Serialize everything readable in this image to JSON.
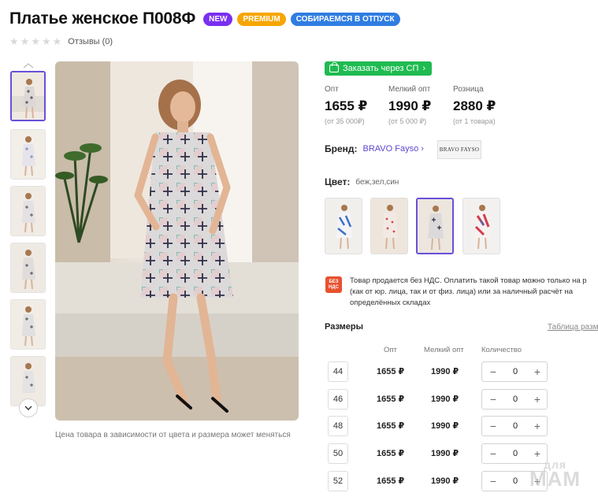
{
  "product": {
    "title": "Платье женское П008Ф",
    "badges": [
      "NEW",
      "PREMIUM",
      "СОБИРАЕМСЯ В ОТПУСК"
    ],
    "rating_stars": 5,
    "rating_value": 0,
    "reviews_label": "Отзывы (0)"
  },
  "gallery": {
    "up_arrow_icon": "chevron-up-icon",
    "down_arrow_icon": "chevron-down-icon",
    "thumbnails_count": 6,
    "active_thumbnail": 1,
    "caption": "Цена товара в зависимости от цвета и размера может меняться"
  },
  "order": {
    "button_label": "Заказать через СП",
    "button_icon": "cart-icon",
    "button_color": "#1fbb51"
  },
  "prices": [
    {
      "label": "Опт",
      "value": "1655 ₽",
      "note": "(от 35 000₽)"
    },
    {
      "label": "Мелкий опт",
      "value": "1990 ₽",
      "note": "(от 5 000 ₽)"
    },
    {
      "label": "Розница",
      "value": "2880 ₽",
      "note": "(от 1 товара)"
    }
  ],
  "brand": {
    "label": "Бренд:",
    "name": "BRAVO Fayso",
    "logo_text": "BRAVO FAYSO"
  },
  "color": {
    "label": "Цвет:",
    "value": "беж,зел,син",
    "swatches_count": 4,
    "active_swatch": 3
  },
  "vat": {
    "icon_text": "БЕЗ НДС",
    "text": "Товар продается без НДС. Оплатить такой товар можно только на р (как от юр. лица, так и от физ. лица) или за наличный расчёт на определённых складах"
  },
  "sizes": {
    "title": "Размеры",
    "table_link": "Таблица разм",
    "columns": [
      "Опт",
      "Мелкий опт",
      "Количество"
    ],
    "rows": [
      {
        "size": "44",
        "opt": "1655 ₽",
        "small": "1990 ₽",
        "qty": "0"
      },
      {
        "size": "46",
        "opt": "1655 ₽",
        "small": "1990 ₽",
        "qty": "0"
      },
      {
        "size": "48",
        "opt": "1655 ₽",
        "small": "1990 ₽",
        "qty": "0"
      },
      {
        "size": "50",
        "opt": "1655 ₽",
        "small": "1990 ₽",
        "qty": "0"
      },
      {
        "size": "52",
        "opt": "1655 ₽",
        "small": "1990 ₽",
        "qty": "0"
      }
    ]
  },
  "watermark": {
    "line1": "для",
    "line2": "МАМ"
  },
  "colors": {
    "accent": "#6a4fd8",
    "new_badge": "#7b2ff0",
    "premium_badge": "#f7a600",
    "vacation_badge": "#2f7de1",
    "vat_icon": "#e8512f"
  }
}
